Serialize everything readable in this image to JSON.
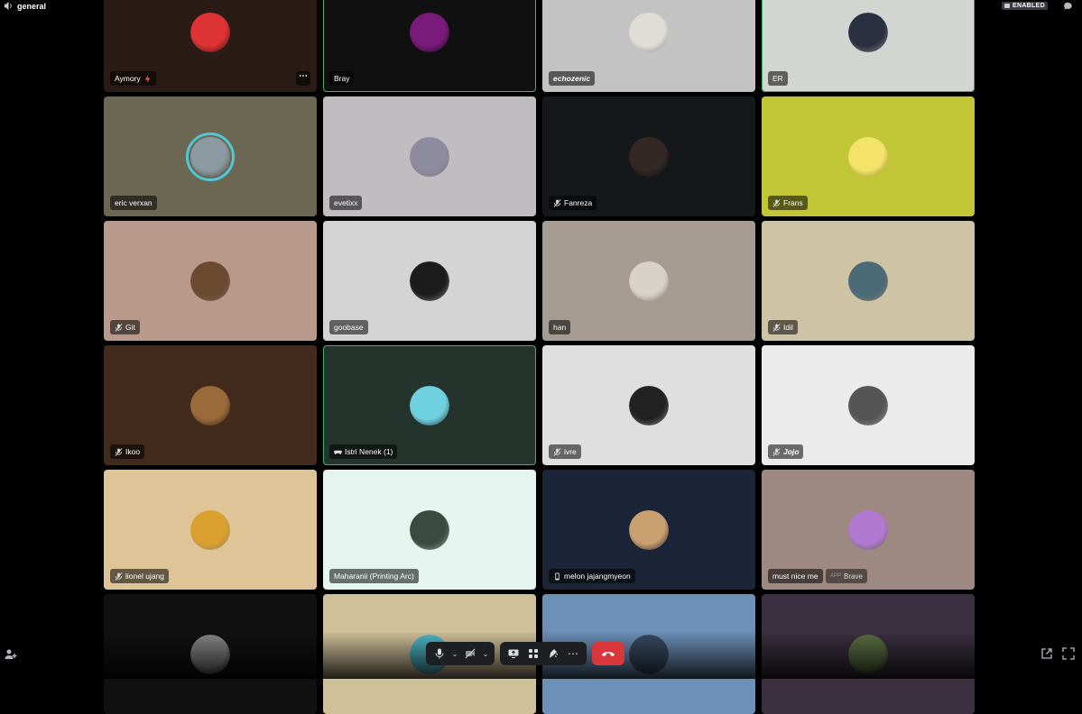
{
  "channel": {
    "name": "general",
    "icon": "speaker-icon"
  },
  "status": {
    "label": "ENABLED"
  },
  "tiles": [
    {
      "name": "Aymory",
      "bg": "#2a1b16",
      "status": "lightning",
      "avatarColor": "#d33"
    },
    {
      "name": "Bray",
      "bg": "#101011",
      "avatarColor": "#7a1a7a",
      "speaking": true
    },
    {
      "name": "echozenic",
      "bg": "#c3c3c3",
      "bold": true,
      "avatarColor": "#e0ddd7"
    },
    {
      "name": "ER",
      "bg": "#d3d5d0",
      "avatarColor": "#2a3040",
      "speaking": true
    },
    {
      "name": "eric verxan",
      "bg": "#6c6752",
      "avatarColor": "#8a9aa0",
      "deco": true
    },
    {
      "name": "evetixx",
      "bg": "#c1bcc0",
      "avatarColor": "#8c8ba0"
    },
    {
      "name": "Fanreza",
      "bg": "#15181b",
      "status": "muted",
      "avatarColor": "#332825"
    },
    {
      "name": "Frans",
      "bg": "#c1c536",
      "status": "muted",
      "avatarColor": "#f3e36a"
    },
    {
      "name": "Git",
      "bg": "#b99a8a",
      "status": "muted",
      "avatarColor": "#6a4a30"
    },
    {
      "name": "goobase",
      "bg": "#d4d4d4",
      "avatarColor": "#1c1c1c"
    },
    {
      "name": "han",
      "bg": "#a59b90",
      "avatarColor": "#d9d2c8"
    },
    {
      "name": "Idil",
      "bg": "#cfc3a5",
      "status": "muted",
      "avatarColor": "#4a6a78"
    },
    {
      "name": "Ikoo",
      "bg": "#422a1d",
      "status": "muted",
      "avatarColor": "#9a6a3a"
    },
    {
      "name": "Istri Nenek (1)",
      "bg": "#25332d",
      "status": "controller",
      "avatarColor": "#6fd0e0",
      "speaking": true
    },
    {
      "name": "ivre",
      "bg": "#e0dfdf",
      "status": "muted",
      "avatarColor": "#222"
    },
    {
      "name": "Jojo",
      "bg": "#ebebeb",
      "status": "muted",
      "bold": true,
      "avatarColor": "#555"
    },
    {
      "name": "lionel ujang",
      "bg": "#dec497",
      "status": "muted",
      "avatarColor": "#d9a030"
    },
    {
      "name": "Maharanii (Printing Arc)",
      "bg": "#e5f5ef",
      "avatarColor": "#3a4a40"
    },
    {
      "name": "melon jajangmyeon",
      "bg": "#1c2438",
      "status": "mobile",
      "avatarColor": "#c9a070"
    },
    {
      "name": "must nice me",
      "bg": "#9d8882",
      "avatarColor": "#b07ad0",
      "badge": "Brave"
    },
    {
      "name": "",
      "bg": "#111111",
      "avatarColor": "#888"
    },
    {
      "name": "",
      "bg": "#cfc09a",
      "avatarColor": "#4fb8c8"
    },
    {
      "name": "",
      "bg": "#6c90b8",
      "avatarColor": "#3a4a60"
    },
    {
      "name": "",
      "bg": "#3a3040",
      "avatarColor": "#5a7040"
    }
  ],
  "badge_label": "APP",
  "controls": {
    "mic": "microphone-icon",
    "camera": "camera-off-icon",
    "share": "screen-share-icon",
    "activities": "activities-icon",
    "soundboard": "soundboard-icon",
    "more": "⋯",
    "hangup": "hang-up-icon"
  }
}
